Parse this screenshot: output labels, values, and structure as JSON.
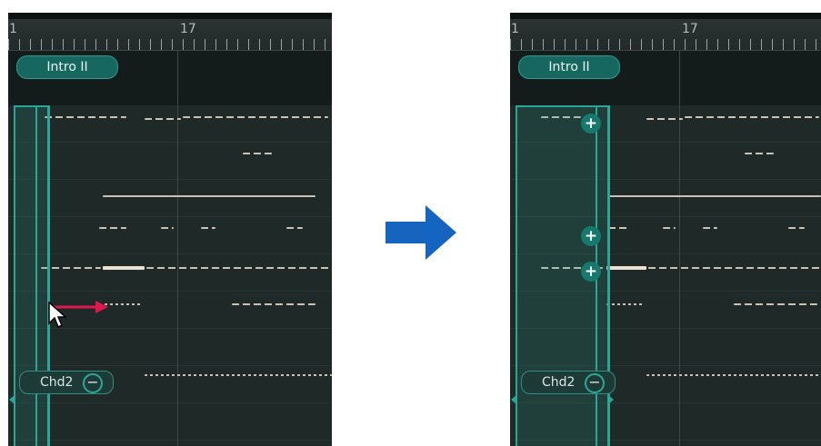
{
  "panels": {
    "before": {
      "ruler": {
        "start_label": "1",
        "mark_label": "17"
      },
      "section_label": "Intro II",
      "chord_label": "Chd2"
    },
    "after": {
      "ruler": {
        "start_label": "1",
        "mark_label": "17"
      },
      "section_label": "Intro II",
      "chord_label": "Chd2",
      "add_buttons": [
        "+",
        "+",
        "+"
      ]
    }
  },
  "chord_minus_symbol": "−",
  "colors": {
    "background": "#1b2423",
    "accent_teal": "#28a697",
    "section_pill": "#16675f",
    "note": "#c9c2b5",
    "drag_arrow": "#e0174f",
    "transition_arrow": "#1565c0"
  },
  "icons": [
    "mouse-cursor-icon",
    "drag-arrow-icon",
    "transition-arrow-icon",
    "plus-icon"
  ]
}
